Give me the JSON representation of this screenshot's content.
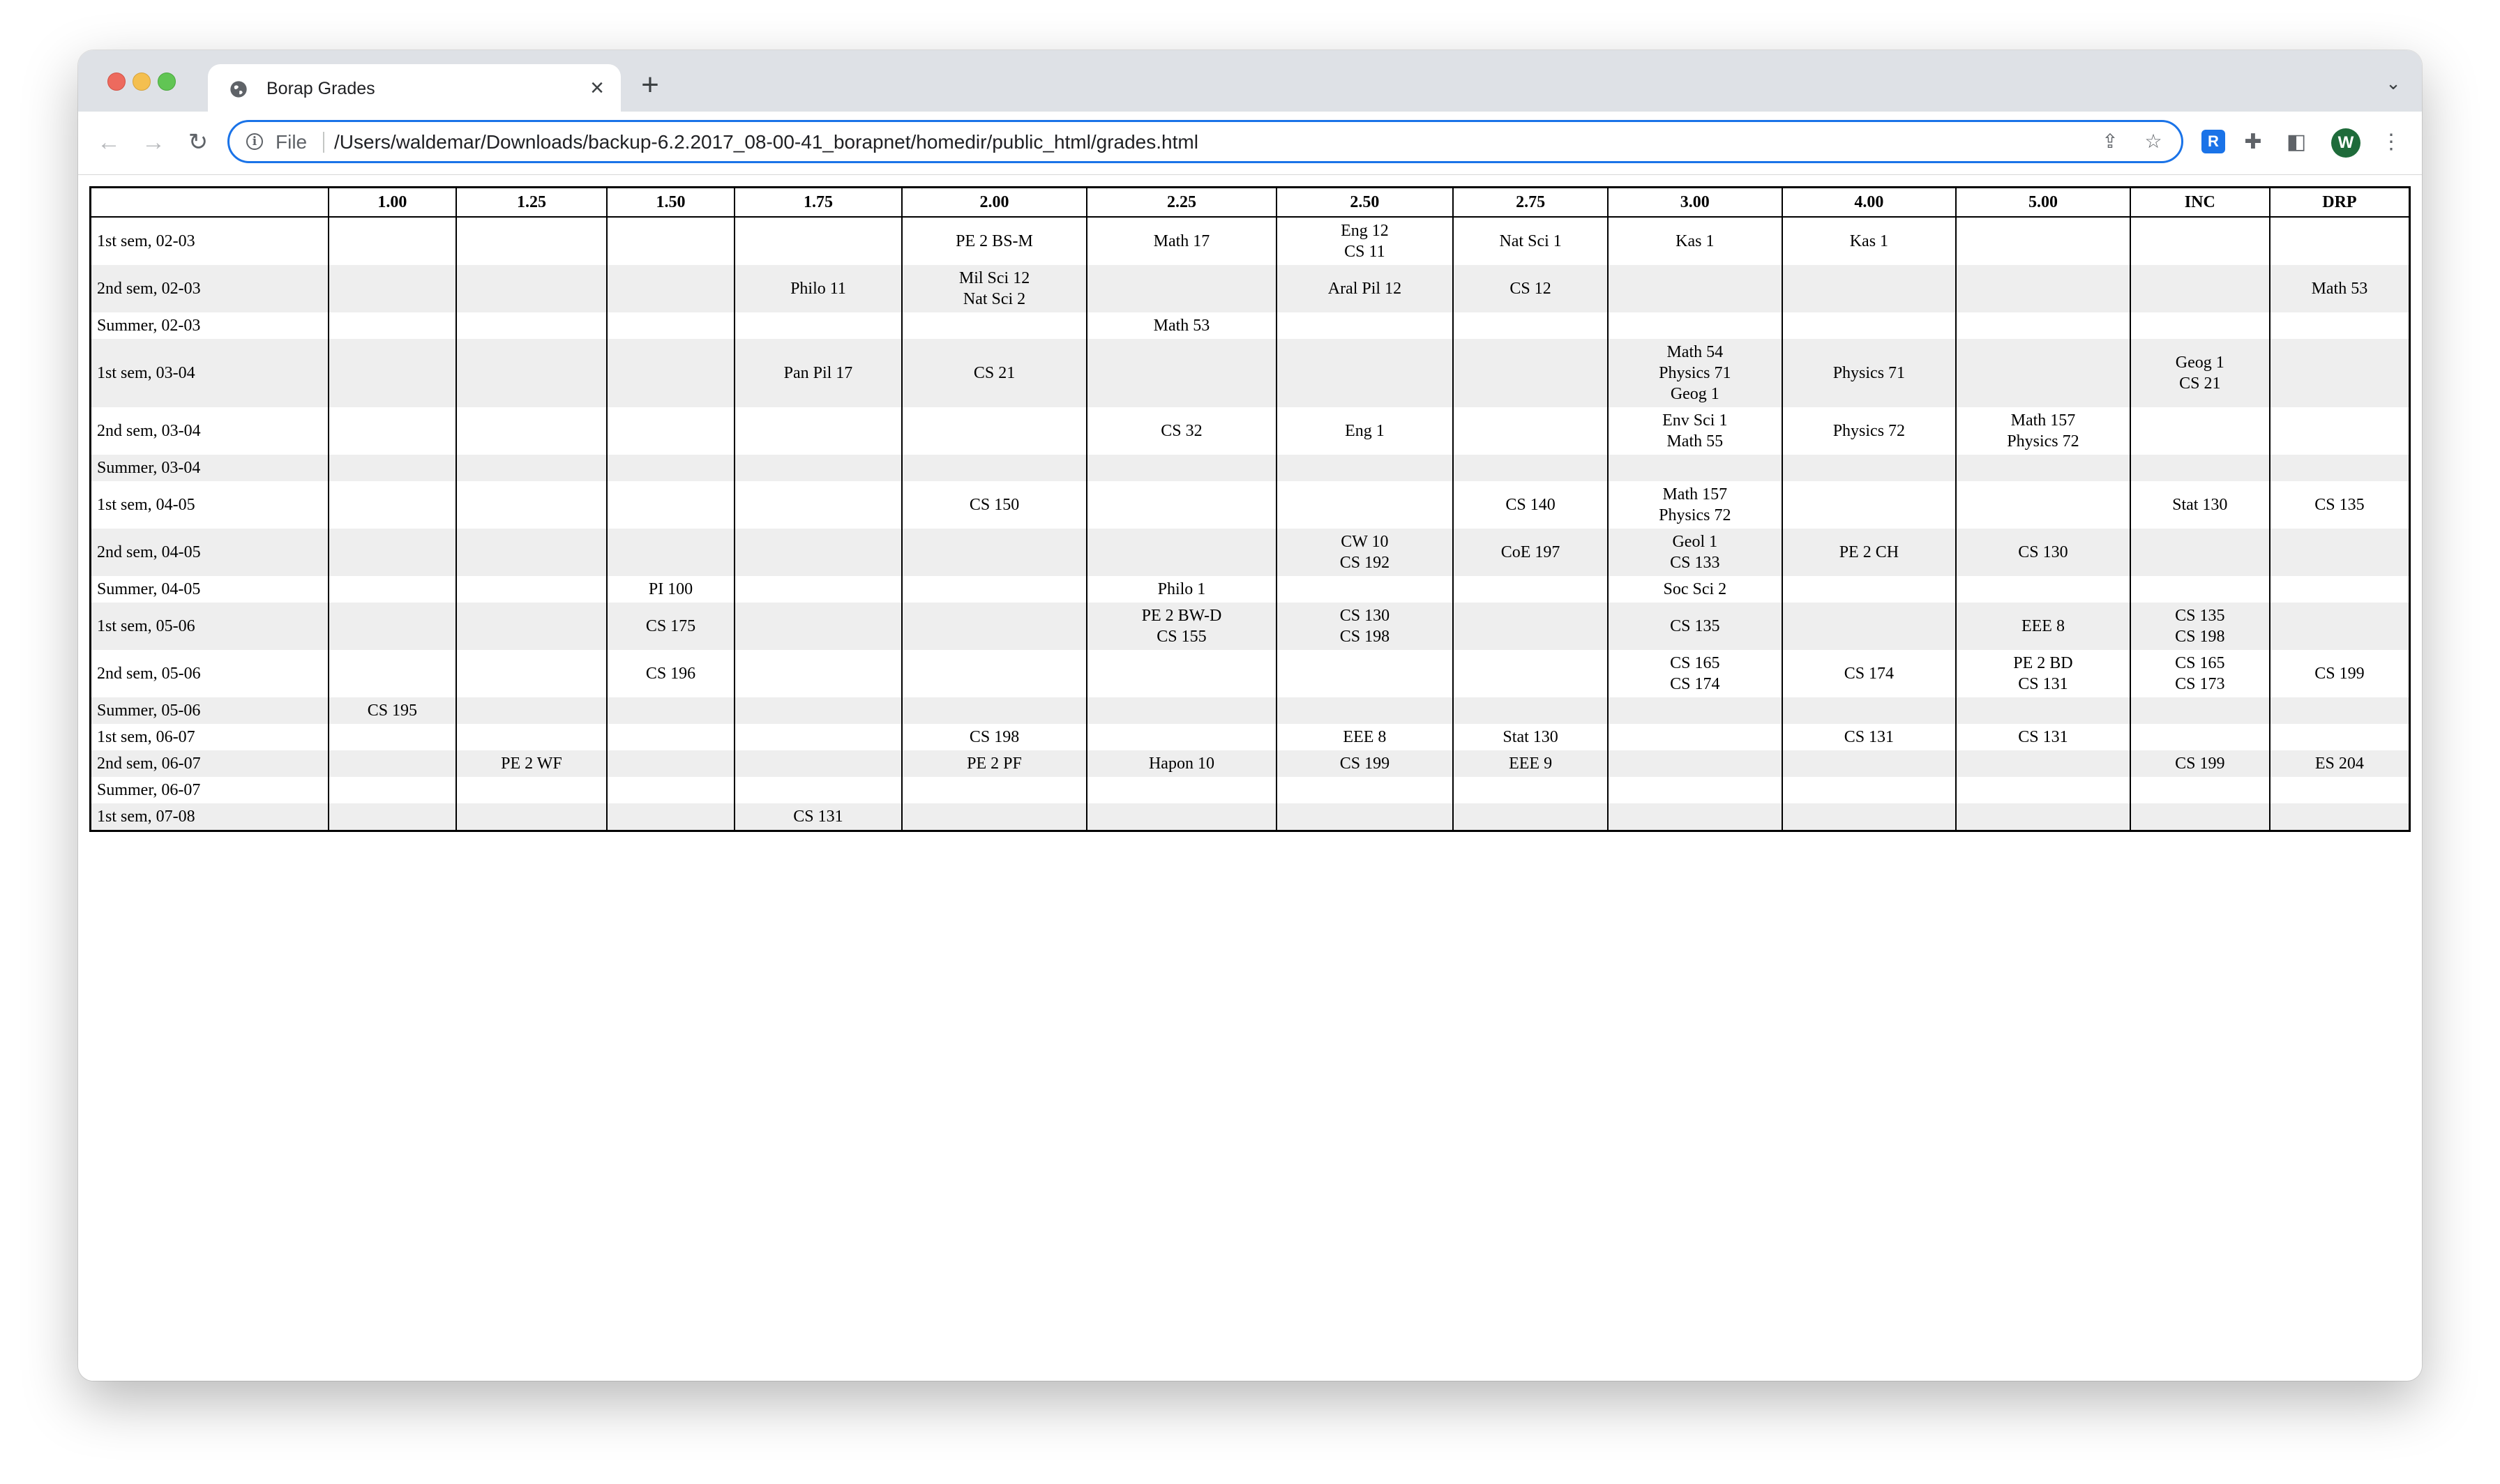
{
  "browser": {
    "tab_title": "Borap Grades",
    "tab_close": "×",
    "new_tab": "+",
    "address_scheme": "File",
    "address_url": "/Users/waldemar/Downloads/backup-6.2.2017_08-00-41_borapnet/homedir/public_html/grades.html",
    "profile_initial": "W",
    "extension_badge": "R"
  },
  "colors": {
    "row_stripe": "#eeeeee",
    "omnibox_focus": "#1a73e8",
    "tabstrip": "#dee1e6"
  },
  "icons": [
    "back-arrow-icon",
    "forward-arrow-icon",
    "reload-icon",
    "info-icon",
    "share-icon",
    "star-icon",
    "extension-icon",
    "puzzle-icon",
    "side-panel-icon",
    "kebab-menu-icon",
    "tab-search-icon",
    "globe-icon"
  ],
  "table": {
    "headers": [
      "",
      "1.00",
      "1.25",
      "1.50",
      "1.75",
      "2.00",
      "2.25",
      "2.50",
      "2.75",
      "3.00",
      "4.00",
      "5.00",
      "INC",
      "DRP"
    ],
    "rows": [
      {
        "semester": "1st sem, 02-03",
        "cells": [
          [],
          [],
          [],
          [],
          [
            "PE 2 BS-M"
          ],
          [
            "Math 17"
          ],
          [
            "Eng 12",
            "CS 11"
          ],
          [
            "Nat Sci 1"
          ],
          [
            "Kas 1"
          ],
          [
            "Kas 1"
          ],
          [],
          [],
          []
        ]
      },
      {
        "semester": "2nd sem, 02-03",
        "cells": [
          [],
          [],
          [],
          [
            "Philo 11"
          ],
          [
            "Mil Sci 12",
            "Nat Sci 2"
          ],
          [],
          [
            "Aral Pil 12"
          ],
          [
            "CS 12"
          ],
          [],
          [],
          [],
          [],
          [
            "Math 53"
          ]
        ]
      },
      {
        "semester": "Summer, 02-03",
        "cells": [
          [],
          [],
          [],
          [],
          [],
          [
            "Math 53"
          ],
          [],
          [],
          [],
          [],
          [],
          [],
          []
        ]
      },
      {
        "semester": "1st sem, 03-04",
        "cells": [
          [],
          [],
          [],
          [
            "Pan Pil 17"
          ],
          [
            "CS 21"
          ],
          [],
          [],
          [],
          [
            "Math 54",
            "Physics 71",
            "Geog 1"
          ],
          [
            "Physics 71"
          ],
          [],
          [
            "Geog 1",
            "CS 21"
          ],
          []
        ]
      },
      {
        "semester": "2nd sem, 03-04",
        "cells": [
          [],
          [],
          [],
          [],
          [],
          [
            "CS 32"
          ],
          [
            "Eng 1"
          ],
          [],
          [
            "Env Sci 1",
            "Math 55"
          ],
          [
            "Physics 72"
          ],
          [
            "Math 157",
            "Physics 72"
          ],
          [],
          []
        ]
      },
      {
        "semester": "Summer, 03-04",
        "cells": [
          [],
          [],
          [],
          [],
          [],
          [],
          [],
          [],
          [],
          [],
          [],
          [],
          []
        ]
      },
      {
        "semester": "1st sem, 04-05",
        "cells": [
          [],
          [],
          [],
          [],
          [
            "CS 150"
          ],
          [],
          [],
          [
            "CS 140"
          ],
          [
            "Math 157",
            "Physics 72"
          ],
          [],
          [],
          [
            "Stat 130"
          ],
          [
            "CS 135"
          ]
        ]
      },
      {
        "semester": "2nd sem, 04-05",
        "cells": [
          [],
          [],
          [],
          [],
          [],
          [],
          [
            "CW 10",
            "CS 192"
          ],
          [
            "CoE 197"
          ],
          [
            "Geol 1",
            "CS 133"
          ],
          [
            "PE 2 CH"
          ],
          [
            "CS 130"
          ],
          [],
          []
        ]
      },
      {
        "semester": "Summer, 04-05",
        "cells": [
          [],
          [],
          [
            "PI 100"
          ],
          [],
          [],
          [
            "Philo 1"
          ],
          [],
          [],
          [
            "Soc Sci 2"
          ],
          [],
          [],
          [],
          []
        ]
      },
      {
        "semester": "1st sem, 05-06",
        "cells": [
          [],
          [],
          [
            "CS 175"
          ],
          [],
          [],
          [
            "PE 2 BW-D",
            "CS 155"
          ],
          [
            "CS 130",
            "CS 198"
          ],
          [],
          [
            "CS 135"
          ],
          [],
          [
            "EEE 8"
          ],
          [
            "CS 135",
            "CS 198"
          ],
          []
        ]
      },
      {
        "semester": "2nd sem, 05-06",
        "cells": [
          [],
          [],
          [
            "CS 196"
          ],
          [],
          [],
          [],
          [],
          [],
          [
            "CS 165",
            "CS 174"
          ],
          [
            "CS 174"
          ],
          [
            "PE 2 BD",
            "CS 131"
          ],
          [
            "CS 165",
            "CS 173"
          ],
          [
            "CS 199"
          ]
        ]
      },
      {
        "semester": "Summer, 05-06",
        "cells": [
          [
            "CS 195"
          ],
          [],
          [],
          [],
          [],
          [],
          [],
          [],
          [],
          [],
          [],
          [],
          []
        ]
      },
      {
        "semester": "1st sem, 06-07",
        "cells": [
          [],
          [],
          [],
          [],
          [
            "CS 198"
          ],
          [],
          [
            "EEE 8"
          ],
          [
            "Stat 130"
          ],
          [],
          [
            "CS 131"
          ],
          [
            "CS 131"
          ],
          [],
          []
        ]
      },
      {
        "semester": "2nd sem, 06-07",
        "cells": [
          [],
          [
            "PE 2 WF"
          ],
          [],
          [],
          [
            "PE 2 PF"
          ],
          [
            "Hapon 10"
          ],
          [
            "CS 199"
          ],
          [
            "EEE 9"
          ],
          [],
          [],
          [],
          [
            "CS 199"
          ],
          [
            "ES 204"
          ]
        ]
      },
      {
        "semester": "Summer, 06-07",
        "cells": [
          [],
          [],
          [],
          [],
          [],
          [],
          [],
          [],
          [],
          [],
          [],
          [],
          []
        ]
      },
      {
        "semester": "1st sem, 07-08",
        "cells": [
          [],
          [],
          [],
          [
            "CS 131"
          ],
          [],
          [],
          [],
          [],
          [],
          [],
          [],
          [],
          []
        ]
      }
    ]
  }
}
